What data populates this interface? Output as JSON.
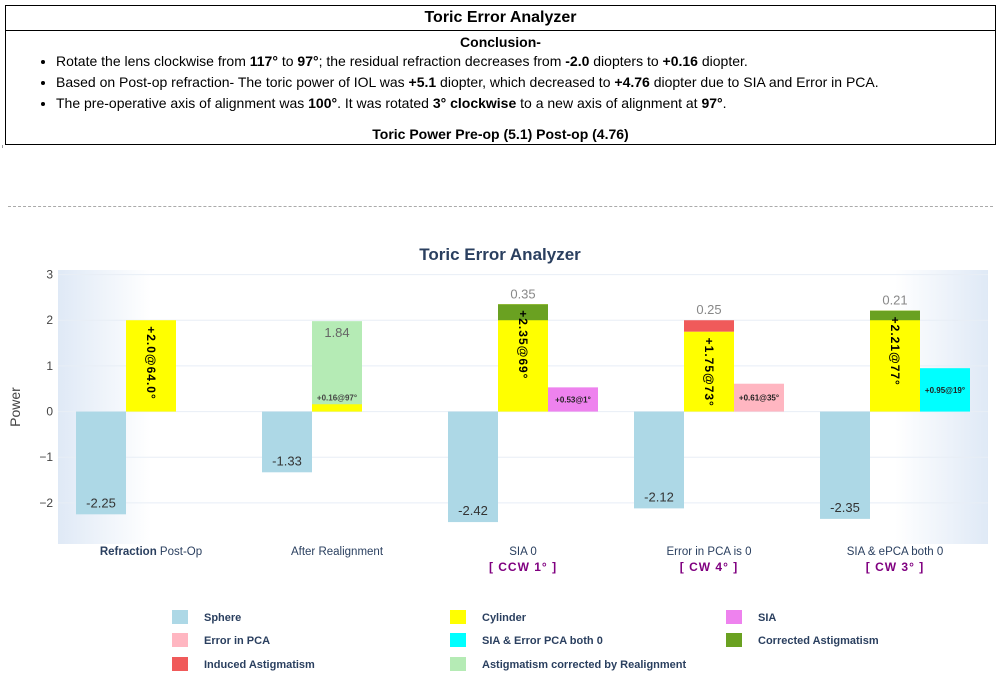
{
  "summary": {
    "title": "Toric Error Analyzer",
    "conclusion_heading": "Conclusion-",
    "bullets": [
      {
        "segments": [
          {
            "t": "Rotate the lens clockwise from ",
            "b": false
          },
          {
            "t": "117°",
            "b": true
          },
          {
            "t": " to ",
            "b": false
          },
          {
            "t": "97°",
            "b": true
          },
          {
            "t": "; the residual refraction decreases from ",
            "b": false
          },
          {
            "t": "-2.0",
            "b": true
          },
          {
            "t": " diopters to ",
            "b": false
          },
          {
            "t": "+0.16",
            "b": true
          },
          {
            "t": " diopter.",
            "b": false
          }
        ]
      },
      {
        "segments": [
          {
            "t": "Based on Post-op refraction- The toric power of IOL was ",
            "b": false
          },
          {
            "t": "+5.1",
            "b": true
          },
          {
            "t": " diopter, which decreased to ",
            "b": false
          },
          {
            "t": "+4.76",
            "b": true
          },
          {
            "t": " diopter due to SIA and Error in PCA.",
            "b": false
          }
        ]
      },
      {
        "segments": [
          {
            "t": "The pre-operative axis of alignment was ",
            "b": false
          },
          {
            "t": "100°",
            "b": true
          },
          {
            "t": ". It was rotated ",
            "b": false
          },
          {
            "t": "3° clockwise",
            "b": true
          },
          {
            "t": " to a new axis of alignment at ",
            "b": false
          },
          {
            "t": "97°",
            "b": true
          },
          {
            "t": ".",
            "b": false
          }
        ]
      }
    ],
    "toric_power_line": "Toric Power Pre-op (5.1) Post-op (4.76)"
  },
  "chart_data": {
    "type": "bar",
    "title": "Toric Error Analyzer",
    "ylabel": "Power",
    "ylim": [
      -2.9,
      3.1
    ],
    "yticks": [
      -2,
      -1,
      0,
      1,
      2,
      3
    ],
    "ytick_labels": [
      "−2",
      "−1",
      "0",
      "1",
      "2",
      "3"
    ],
    "grid": true,
    "categories": [
      {
        "bold": "Refraction",
        "rest": " Post-Op",
        "sub": ""
      },
      {
        "bold": "",
        "rest": "After Realignment",
        "sub": ""
      },
      {
        "bold": "",
        "rest": "SIA 0",
        "sub": "[ CCW 1° ]"
      },
      {
        "bold": "",
        "rest": "Error in PCA is 0",
        "sub": "[ CW 4° ]"
      },
      {
        "bold": "",
        "rest": "SIA  & ePCA both 0",
        "sub": "[ CW 3° ]"
      }
    ],
    "bars": [
      {
        "group": 0,
        "slot": 0,
        "series": "Sphere",
        "base": 0,
        "value": -2.25,
        "label": "-2.25",
        "label_style": "inside-bottom"
      },
      {
        "group": 0,
        "slot": 1,
        "series": "Cylinder",
        "base": 0,
        "value": 2.0,
        "label": "+2.0@64.0°",
        "label_style": "vertical"
      },
      {
        "group": 1,
        "slot": 0,
        "series": "Sphere",
        "base": 0,
        "value": -1.33,
        "label": "-1.33",
        "label_style": "inside-bottom"
      },
      {
        "group": 1,
        "slot": 1,
        "series": "Astigmatism corrected by Realignment",
        "base": 0,
        "value": 1.98,
        "label": "1.84",
        "label_style": "inside-top"
      },
      {
        "group": 1,
        "slot": 1,
        "series": "Cylinder",
        "base": 0,
        "value": 0.16,
        "label": "+0.16@97°",
        "label_style": "small-above"
      },
      {
        "group": 2,
        "slot": 0,
        "series": "Sphere",
        "base": 0,
        "value": -2.42,
        "label": "-2.42",
        "label_style": "inside-bottom"
      },
      {
        "group": 2,
        "slot": 1,
        "series": "Cylinder",
        "base": 0,
        "value": 2.35,
        "label": "+2.35@69°",
        "label_style": "vertical"
      },
      {
        "group": 2,
        "slot": 1,
        "series": "Corrected Astigmatism",
        "base": 2.0,
        "value": 0.35,
        "label": "0.35",
        "label_style": "above"
      },
      {
        "group": 2,
        "slot": 2,
        "series": "SIA",
        "base": 0,
        "value": 0.53,
        "label": "+0.53@1°",
        "label_style": "small-inside"
      },
      {
        "group": 3,
        "slot": 0,
        "series": "Sphere",
        "base": 0,
        "value": -2.12,
        "label": "-2.12",
        "label_style": "inside-bottom"
      },
      {
        "group": 3,
        "slot": 1,
        "series": "Cylinder",
        "base": 0,
        "value": 1.75,
        "label": "+1.75@73°",
        "label_style": "vertical"
      },
      {
        "group": 3,
        "slot": 1,
        "series": "Induced Astigmatism",
        "base": 1.75,
        "value": 0.25,
        "label": "0.25",
        "label_style": "above"
      },
      {
        "group": 3,
        "slot": 2,
        "series": "Error in PCA",
        "base": 0,
        "value": 0.61,
        "label": "+0.61@35°",
        "label_style": "small-inside"
      },
      {
        "group": 4,
        "slot": 0,
        "series": "Sphere",
        "base": 0,
        "value": -2.35,
        "label": "-2.35",
        "label_style": "inside-bottom"
      },
      {
        "group": 4,
        "slot": 1,
        "series": "Cylinder",
        "base": 0,
        "value": 2.21,
        "label": "+2.21@77°",
        "label_style": "vertical"
      },
      {
        "group": 4,
        "slot": 1,
        "series": "Corrected Astigmatism",
        "base": 2.0,
        "value": 0.21,
        "label": "0.21",
        "label_style": "above"
      },
      {
        "group": 4,
        "slot": 2,
        "series": "SIA  & Error PCA both 0",
        "base": 0,
        "value": 0.95,
        "label": "+0.95@19°",
        "label_style": "small-inside"
      }
    ],
    "legend": [
      {
        "name": "Sphere",
        "color": "#add8e6"
      },
      {
        "name": "Cylinder",
        "color": "#ffff00"
      },
      {
        "name": "SIA",
        "color": "#ee82ee"
      },
      {
        "name": "Error in PCA",
        "color": "#ffb6c1"
      },
      {
        "name": "SIA  & Error PCA both 0",
        "color": "#00ffff"
      },
      {
        "name": "Corrected Astigmatism",
        "color": "#6aa121"
      },
      {
        "name": "Induced Astigmatism",
        "color": "#f05a5a"
      },
      {
        "name": "Astigmatism corrected by Realignment",
        "color": "#b5ebb5"
      }
    ],
    "colors": {
      "title": "#2a3f5f",
      "sub_label": "#800080",
      "category_label": "#2a3f5f",
      "gridline": "#e8eef6"
    }
  }
}
